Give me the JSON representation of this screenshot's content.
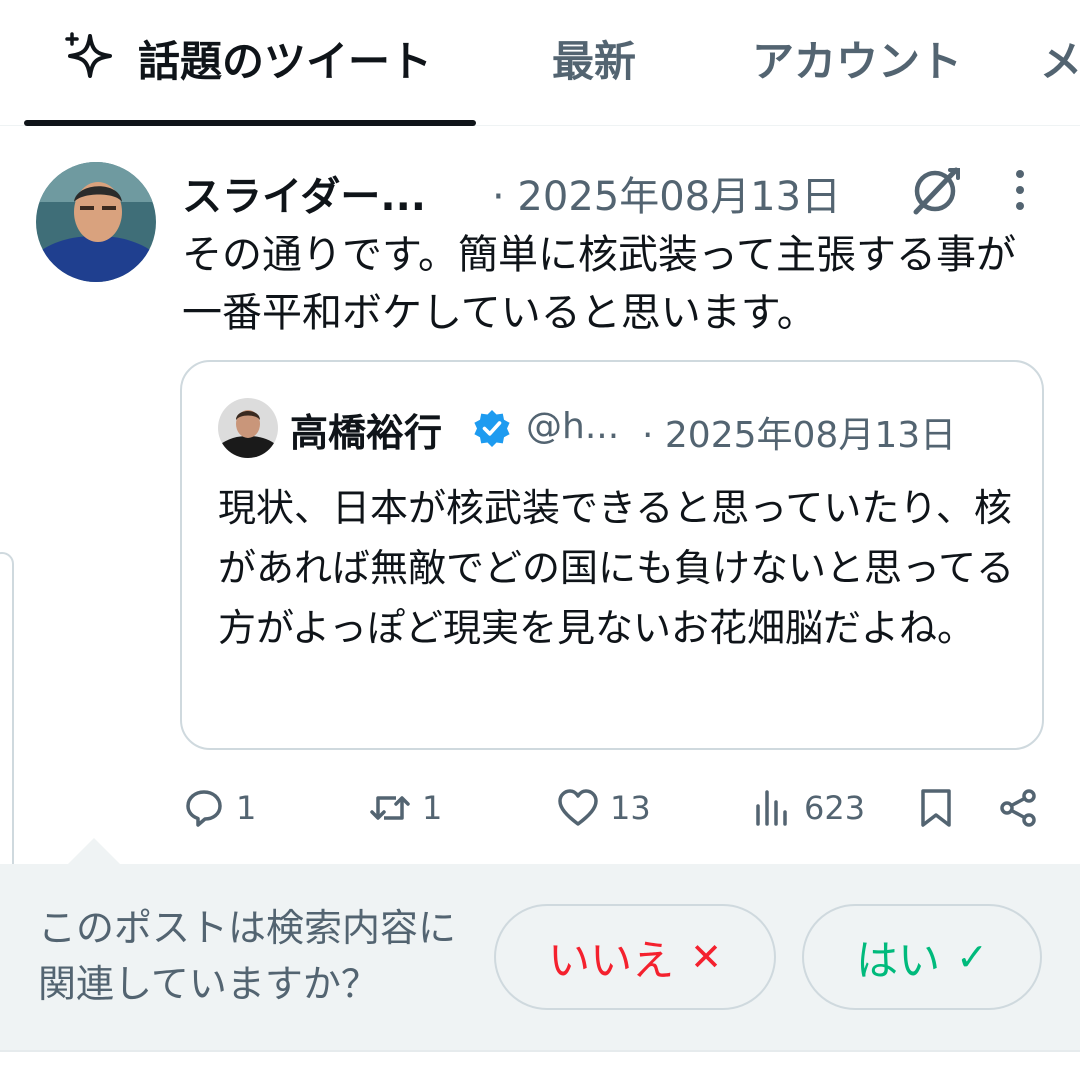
{
  "tabs": [
    {
      "label": "話題のツイート",
      "icon": "sparkle-icon",
      "active": true
    },
    {
      "label": "最新",
      "active": false
    },
    {
      "label": "アカウント",
      "active": false
    },
    {
      "label": "メ",
      "active": false
    }
  ],
  "tweet": {
    "author_name": "スライダー...",
    "date": "· 2025年08月13日",
    "text": "その通りです。簡単に核武装って主張する事が一番平和ボケしていると思います。",
    "quote": {
      "author_name": "高橋裕行",
      "verified": true,
      "handle": "@h...",
      "date": "· 2025年08月13日",
      "text": "現状、日本が核武装できると思っていたり、核があれば無敵でどの国にも負けないと思ってる方がよっぽど現実を見ないお花畑脳だよね。"
    },
    "stats": {
      "replies": "1",
      "reposts": "1",
      "likes": "13",
      "views": "623"
    }
  },
  "relevance_prompt": {
    "question": "このポストは検索内容に関連していますか？",
    "no_label": "いいえ",
    "no_mark": "✕",
    "yes_label": "はい",
    "yes_mark": "✓"
  },
  "colors": {
    "text_primary": "#0f1419",
    "text_secondary": "#536471",
    "verified_blue": "#1d9bf0",
    "no_red": "#f4212e",
    "yes_green": "#00ba7c",
    "prompt_bg": "#eff3f4"
  }
}
